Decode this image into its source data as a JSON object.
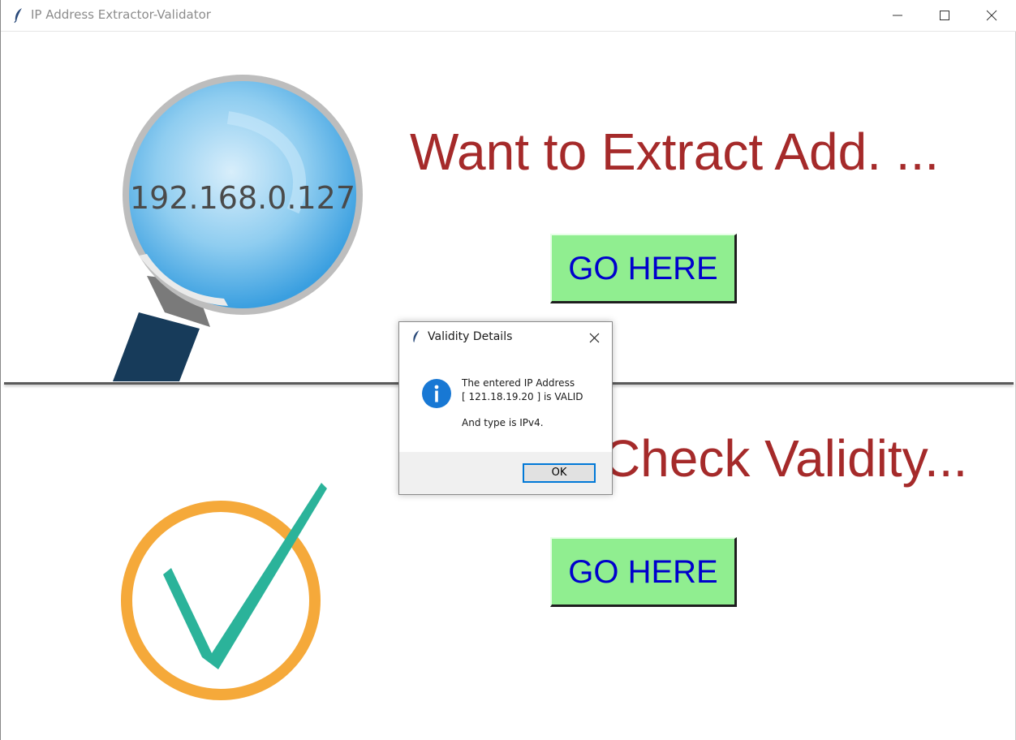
{
  "window": {
    "title": "IP Address Extractor-Validator"
  },
  "top_panel": {
    "heading": "Want to Extract Add. ...",
    "button_label": "GO HERE",
    "image_ip_text": "192.168.0.127"
  },
  "bottom_panel": {
    "heading": "Want to Check Validity...",
    "button_label": "GO HERE"
  },
  "dialog": {
    "title": "Validity Details",
    "message_line1": "The entered IP Address",
    "message_line2": "[ 121.18.19.20 ] is VALID",
    "message_line3": "And type is IPv4.",
    "ok_label": "OK",
    "icon": "info-icon"
  },
  "colors": {
    "heading": "#a52a2a",
    "button_bg": "#90ee90",
    "button_text": "#0000cd",
    "dialog_accent": "#0078d7"
  }
}
